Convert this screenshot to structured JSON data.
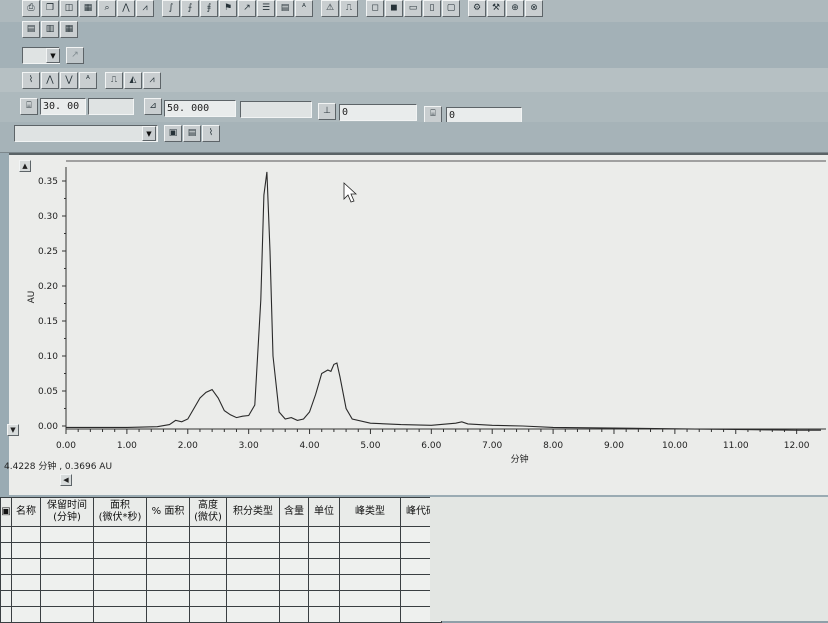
{
  "toolbar": {
    "row1_icons": [
      "print-icon",
      "copy-icon",
      "preview-icon",
      "grid-icon",
      "zoom-icon",
      "peak-icon",
      "peak2-icon",
      "sep",
      "integrate-icon",
      "integrate2-icon",
      "integrate3-icon",
      "flag-icon",
      "cursor-icon",
      "list-icon",
      "report-icon",
      "label-icon",
      "sep",
      "warning-icon",
      "baseline-icon",
      "sep",
      "window-icon",
      "window2-icon",
      "window3-icon",
      "window4-icon",
      "window5-icon",
      "sep",
      "tool-icon",
      "tool2-icon",
      "tool3-icon",
      "tool4-icon"
    ]
  },
  "params": {
    "time_value": "30. 00",
    "time_blank": "",
    "au_value": "50. 000",
    "au_blank": "",
    "threshold_value": "0",
    "offset_value": "0"
  },
  "chart_data": {
    "type": "line",
    "xlabel": "分钟",
    "ylabel": "AU",
    "xlim": [
      0.0,
      12.4
    ],
    "ylim": [
      -0.01,
      0.37
    ],
    "x_ticks": [
      "0.00",
      "1.00",
      "2.00",
      "3.00",
      "4.00",
      "5.00",
      "6.00",
      "7.00",
      "8.00",
      "9.00",
      "10.00",
      "11.00",
      "12.00"
    ],
    "y_ticks": [
      "0.00",
      "0.05",
      "0.10",
      "0.15",
      "0.20",
      "0.25",
      "0.30",
      "0.35"
    ],
    "grid": false,
    "series": [
      {
        "x": [
          0.0,
          0.5,
          1.0,
          1.5,
          1.7,
          1.8,
          1.9,
          2.0,
          2.1,
          2.2,
          2.3,
          2.4,
          2.5,
          2.6,
          2.7,
          2.8,
          2.9,
          3.0,
          3.1,
          3.2,
          3.25,
          3.3,
          3.35,
          3.4,
          3.5,
          3.6,
          3.7,
          3.8,
          3.9,
          4.0,
          4.1,
          4.2,
          4.3,
          4.35,
          4.4,
          4.45,
          4.5,
          4.6,
          4.7,
          5.0,
          5.5,
          6.0,
          6.4,
          6.5,
          6.6,
          7.0,
          7.5,
          8.0,
          9.0,
          10.0,
          11.0,
          12.0,
          12.4
        ],
        "y": [
          -0.002,
          -0.002,
          -0.002,
          -0.001,
          0.002,
          0.008,
          0.006,
          0.01,
          0.025,
          0.04,
          0.048,
          0.052,
          0.04,
          0.022,
          0.016,
          0.012,
          0.014,
          0.015,
          0.03,
          0.18,
          0.33,
          0.363,
          0.25,
          0.1,
          0.02,
          0.01,
          0.012,
          0.008,
          0.01,
          0.02,
          0.045,
          0.075,
          0.08,
          0.078,
          0.088,
          0.09,
          0.07,
          0.025,
          0.01,
          0.004,
          0.002,
          0.001,
          0.004,
          0.006,
          0.003,
          0.001,
          0.0,
          -0.002,
          -0.003,
          -0.004,
          -0.005,
          -0.006,
          -0.006
        ]
      }
    ]
  },
  "cursor_readout": "4.4228 分钟 , 0.3696 AU",
  "table": {
    "columns": [
      "名称",
      "保留时间\n(分钟)",
      "面积\n(微伏*秒)",
      "% 面积",
      "高度\n(微伏)",
      "积分类型",
      "含量",
      "单位",
      "峰类型",
      "峰代码"
    ],
    "empty_rows": 6
  }
}
